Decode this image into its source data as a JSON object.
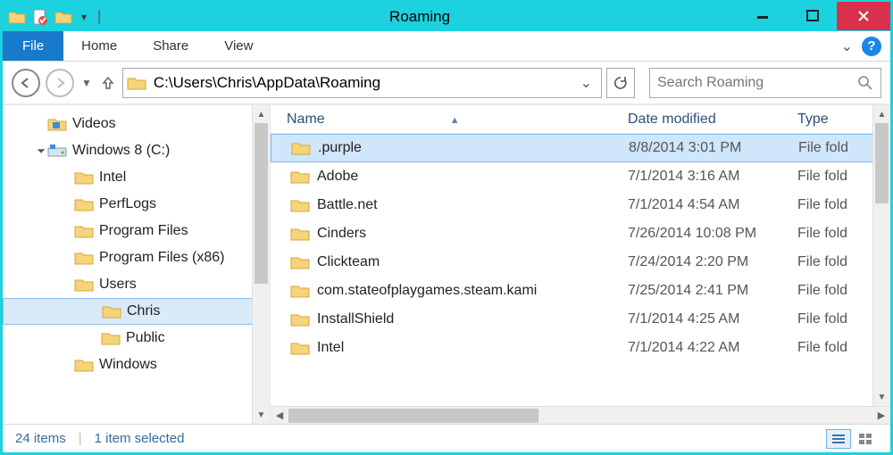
{
  "window": {
    "title": "Roaming"
  },
  "ribbon": {
    "file": "File",
    "tabs": [
      "Home",
      "Share",
      "View"
    ]
  },
  "nav": {
    "path": "C:\\Users\\Chris\\AppData\\Roaming",
    "search_placeholder": "Search Roaming"
  },
  "tree": [
    {
      "indent": 50,
      "label": "Videos",
      "icon": "videos"
    },
    {
      "indent": 50,
      "label": "Windows 8 (C:)",
      "icon": "drive",
      "expander": "open"
    },
    {
      "indent": 80,
      "label": "Intel",
      "icon": "folder"
    },
    {
      "indent": 80,
      "label": "PerfLogs",
      "icon": "folder"
    },
    {
      "indent": 80,
      "label": "Program Files",
      "icon": "folder"
    },
    {
      "indent": 80,
      "label": "Program Files (x86)",
      "icon": "folder"
    },
    {
      "indent": 80,
      "label": "Users",
      "icon": "folder"
    },
    {
      "indent": 110,
      "label": "Chris",
      "icon": "folder",
      "selected": true
    },
    {
      "indent": 110,
      "label": "Public",
      "icon": "folder"
    },
    {
      "indent": 80,
      "label": "Windows",
      "icon": "folder"
    }
  ],
  "columns": {
    "name": "Name",
    "date": "Date modified",
    "type": "Type"
  },
  "files": [
    {
      "name": ".purple",
      "date": "8/8/2014 3:01 PM",
      "type": "File fold",
      "selected": true
    },
    {
      "name": "Adobe",
      "date": "7/1/2014 3:16 AM",
      "type": "File fold"
    },
    {
      "name": "Battle.net",
      "date": "7/1/2014 4:54 AM",
      "type": "File fold"
    },
    {
      "name": "Cinders",
      "date": "7/26/2014 10:08 PM",
      "type": "File fold"
    },
    {
      "name": "Clickteam",
      "date": "7/24/2014 2:20 PM",
      "type": "File fold"
    },
    {
      "name": "com.stateofplaygames.steam.kami",
      "date": "7/25/2014 2:41 PM",
      "type": "File fold"
    },
    {
      "name": "InstallShield",
      "date": "7/1/2014 4:25 AM",
      "type": "File fold"
    },
    {
      "name": "Intel",
      "date": "7/1/2014 4:22 AM",
      "type": "File fold"
    }
  ],
  "status": {
    "count": "24 items",
    "selection": "1 item selected"
  }
}
